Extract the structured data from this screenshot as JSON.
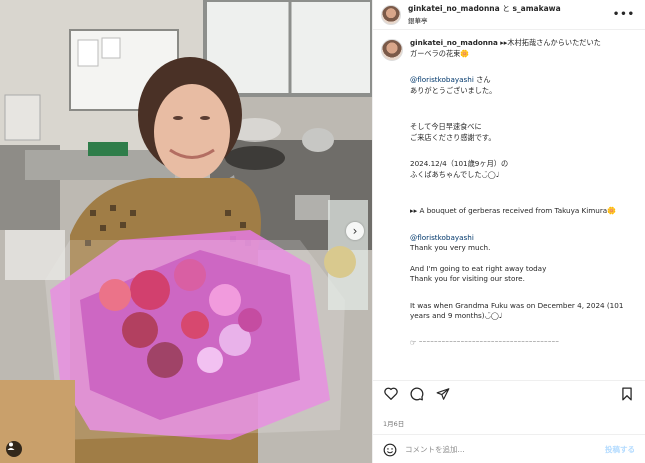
{
  "header": {
    "user1": "ginkatei_no_madonna",
    "and": "と",
    "user2": "s_amakawa",
    "location": "銀華亭"
  },
  "caption": {
    "user": "ginkatei_no_madonna",
    "line1": "▸▸木村拓哉さんからいただいた",
    "line2": "ガーベラの花束🌼",
    "mention1": "@floristkobayashi",
    "jp_thanks_suffix": " さん",
    "jp_thanks2": "ありがとうございました。",
    "jp_para2": "そして今日早速食べに\nご来店くださり感謝です。",
    "jp_para3": "2024.12/4（101歳9ヶ月）の\nふくばあちゃんでした◡̈◯♩",
    "en_line1": "▸▸ A bouquet of gerberas received from Takuya Kimura🌼",
    "mention2": "@floristkobayashi",
    "en_thanks": "Thank you very much.",
    "en_para2": "And I'm going to eat right away today\nThank you for visiting our store.",
    "en_para3": "It was when Grandma Fuku was on December 4, 2024 (101 years and 9 months)◡̈◯♩",
    "trailing": "☞ ⁻⁻⁻⁻⁻⁻⁻⁻⁻⁻⁻⁻⁻⁻⁻⁻⁻⁻⁻⁻⁻⁻⁻⁻⁻⁻⁻⁻⁻⁻⁻⁻⁻⁻⁻⁻⁻"
  },
  "footer": {
    "date": "1月6日",
    "comment_placeholder": "コメントを追加...",
    "post_label": "投稿する"
  },
  "icons": {
    "like": "heart-icon",
    "comment": "comment-icon",
    "share": "share-icon",
    "save": "bookmark-icon",
    "more": "more-icon",
    "emoji": "emoji-icon",
    "carousel_next": "chevron-right-icon",
    "tagged": "person-tag-icon"
  },
  "colors": {
    "mention": "#00376b",
    "post_button": "#b3dbff",
    "border": "#efefef"
  }
}
